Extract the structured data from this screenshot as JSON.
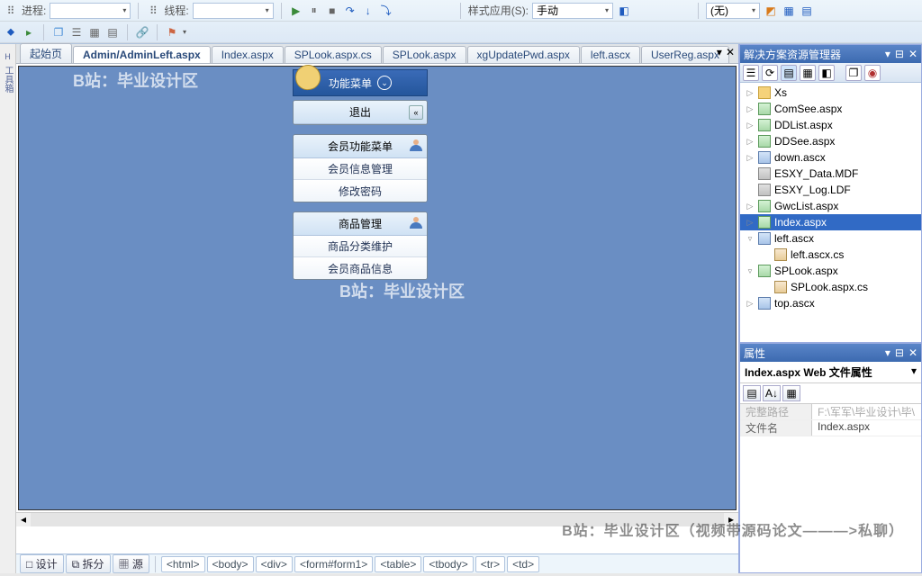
{
  "toolbars": {
    "row1": {
      "process_label": "进程:",
      "thread_label": "线程:",
      "style_label": "样式应用(S):",
      "style_value": "手动",
      "none_value": "(无)"
    }
  },
  "left_margin": {
    "label": "工具箱"
  },
  "tabs": [
    {
      "label": "起始页",
      "active": false
    },
    {
      "label": "Admin/AdminLeft.aspx",
      "active": true
    },
    {
      "label": "Index.aspx",
      "active": false
    },
    {
      "label": "SPLook.aspx.cs",
      "active": false
    },
    {
      "label": "SPLook.aspx",
      "active": false
    },
    {
      "label": "xgUpdatePwd.aspx",
      "active": false
    },
    {
      "label": "left.ascx",
      "active": false
    },
    {
      "label": "UserReg.aspx",
      "active": false
    }
  ],
  "watermark_top": "B站：毕业设计区",
  "watermark_mid": "B站：毕业设计区",
  "watermark_bottom": "B站：毕业设计区（视频带源码论文———>私聊）",
  "menu": {
    "title": "功能菜单",
    "g0": {
      "title": "退出"
    },
    "g1": {
      "title": "会员功能菜单",
      "items": [
        "会员信息管理",
        "修改密码"
      ]
    },
    "g2": {
      "title": "商品管理",
      "items": [
        "商品分类维护",
        "会员商品信息"
      ]
    }
  },
  "status": {
    "modes": [
      "设计",
      "拆分",
      "源"
    ],
    "breadcrumb": [
      "<html>",
      "<body>",
      "<div>",
      "<form#form1>",
      "<table>",
      "<tbody>",
      "<tr>",
      "<td>"
    ]
  },
  "solution": {
    "title": "解决方案资源管理器",
    "tree": [
      {
        "indent": 0,
        "exp": "▷",
        "icon": "folder",
        "label": "Xs"
      },
      {
        "indent": 0,
        "exp": "▷",
        "icon": "aspx",
        "label": "ComSee.aspx"
      },
      {
        "indent": 0,
        "exp": "▷",
        "icon": "aspx",
        "label": "DDList.aspx"
      },
      {
        "indent": 0,
        "exp": "▷",
        "icon": "aspx",
        "label": "DDSee.aspx"
      },
      {
        "indent": 0,
        "exp": "▷",
        "icon": "ascx",
        "label": "down.ascx"
      },
      {
        "indent": 0,
        "exp": "",
        "icon": "db",
        "label": "ESXY_Data.MDF"
      },
      {
        "indent": 0,
        "exp": "",
        "icon": "db",
        "label": "ESXY_Log.LDF"
      },
      {
        "indent": 0,
        "exp": "▷",
        "icon": "aspx",
        "label": "GwcList.aspx"
      },
      {
        "indent": 0,
        "exp": "▷",
        "icon": "aspx",
        "label": "Index.aspx",
        "selected": true
      },
      {
        "indent": 0,
        "exp": "▿",
        "icon": "ascx",
        "label": "left.ascx"
      },
      {
        "indent": 1,
        "exp": "",
        "icon": "cs",
        "label": "left.ascx.cs"
      },
      {
        "indent": 0,
        "exp": "▿",
        "icon": "aspx",
        "label": "SPLook.aspx"
      },
      {
        "indent": 1,
        "exp": "",
        "icon": "cs",
        "label": "SPLook.aspx.cs"
      },
      {
        "indent": 0,
        "exp": "▷",
        "icon": "ascx",
        "label": "top.ascx"
      }
    ]
  },
  "properties": {
    "title": "属性",
    "header": "Index.aspx Web 文件属性",
    "rows": [
      {
        "k": "完整路径",
        "v": "F:\\军军\\毕业设计\\毕\\",
        "disabled": true
      },
      {
        "k": "文件名",
        "v": "Index.aspx",
        "disabled": false
      }
    ]
  }
}
